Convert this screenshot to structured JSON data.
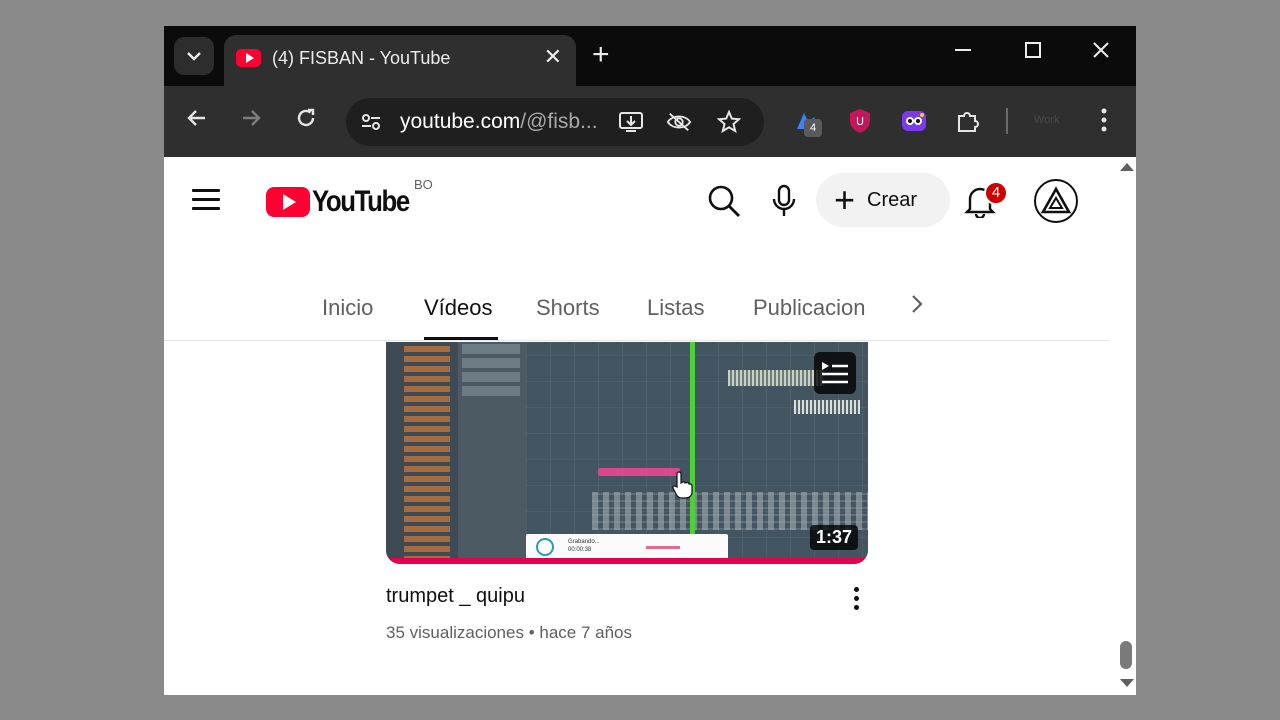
{
  "browser": {
    "tab_title": "(4) FISBAN - YouTube",
    "tab_close": "✕",
    "new_tab": "+",
    "url_main": "youtube.com",
    "url_path": "/@fisb...",
    "extension_badge": "4",
    "profile_label": "Work"
  },
  "youtube": {
    "country_code": "BO",
    "create_label": "Crear",
    "notification_count": "4",
    "tabs": [
      {
        "label": "Inicio"
      },
      {
        "label": "Vídeos"
      },
      {
        "label": "Shorts"
      },
      {
        "label": "Listas"
      },
      {
        "label": "Publicacion"
      }
    ],
    "active_tab": "Vídeos",
    "video": {
      "title": "trumpet _ quipu",
      "meta": "35 visualizaciones • hace 7 años",
      "duration": "1:37",
      "recorder_label": "Grabando...",
      "recorder_time": "00:00:38"
    }
  },
  "colors": {
    "youtube_red": "#ff0033",
    "tab_strip": "#0b0b0b",
    "toolbar": "#2f2f2f",
    "playhead": "#4fcf3a"
  }
}
